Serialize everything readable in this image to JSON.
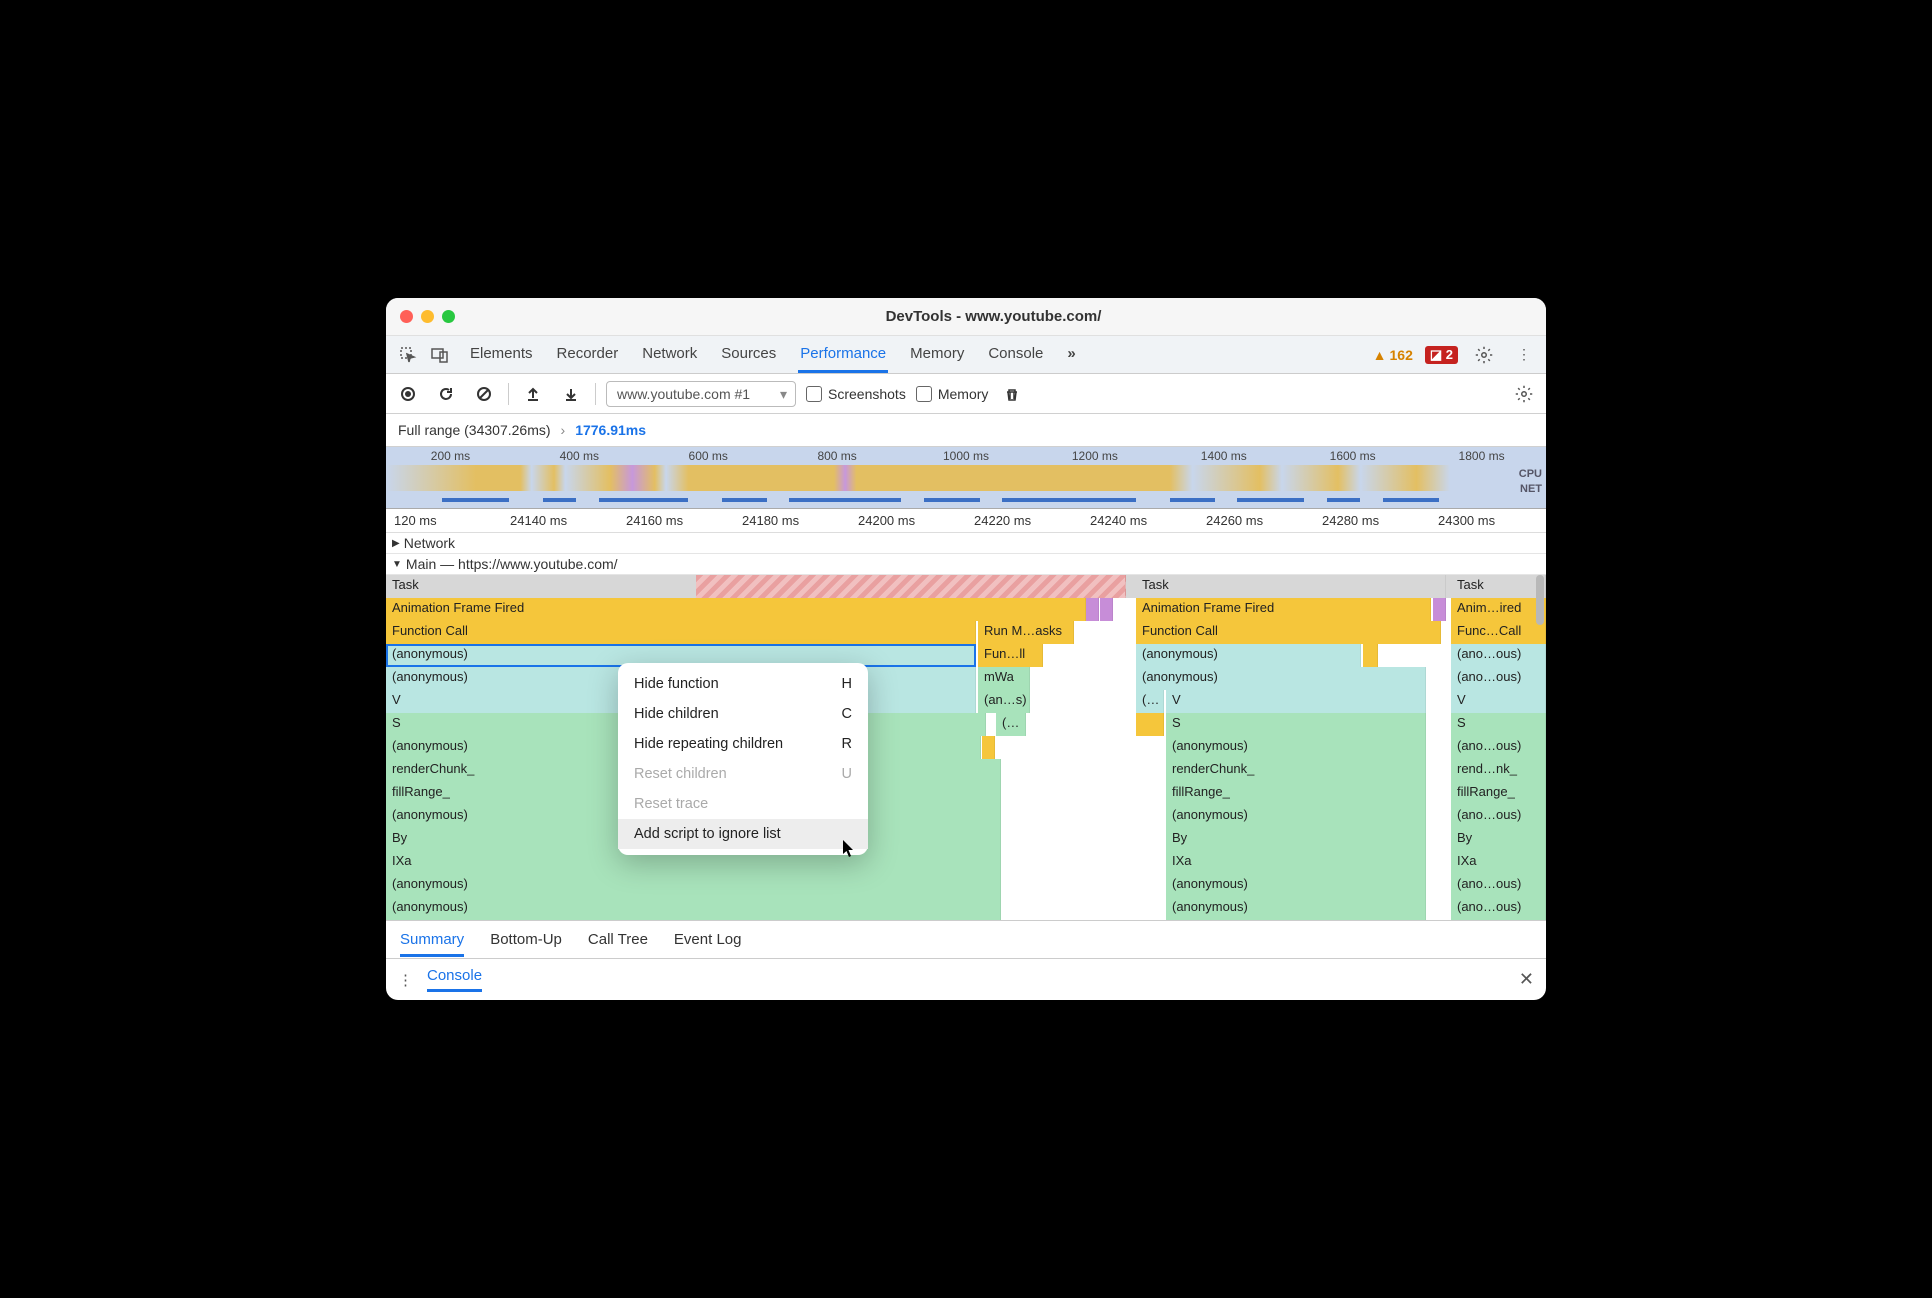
{
  "window": {
    "title": "DevTools - www.youtube.com/"
  },
  "tabs": [
    "Elements",
    "Recorder",
    "Network",
    "Sources",
    "Performance",
    "Memory",
    "Console"
  ],
  "active_tab": "Performance",
  "more_tabs_glyph": "»",
  "issues": {
    "warnings": 162,
    "errors": 2
  },
  "toolbar": {
    "profile_select": "www.youtube.com #1",
    "screenshots_label": "Screenshots",
    "memory_label": "Memory"
  },
  "breadcrumb": {
    "full": "Full range (34307.26ms)",
    "sep": "›",
    "current": "1776.91ms"
  },
  "overview_ticks": [
    "200 ms",
    "400 ms",
    "600 ms",
    "800 ms",
    "1000 ms",
    "1200 ms",
    "1400 ms",
    "1600 ms",
    "1800 ms"
  ],
  "overview_labels": {
    "cpu": "CPU",
    "net": "NET"
  },
  "ruler_ticks": [
    "120 ms",
    "24140 ms",
    "24160 ms",
    "24180 ms",
    "24200 ms",
    "24220 ms",
    "24240 ms",
    "24260 ms",
    "24280 ms",
    "24300 ms"
  ],
  "tracks": {
    "network": "Network",
    "main": "Main — https://www.youtube.com/"
  },
  "flame": {
    "col1": {
      "task": "Task",
      "aff": "Animation Frame Fired",
      "fc": "Function Call",
      "run": "Run M…asks",
      "anon1_sel": "(anonymous)",
      "fun2": "Fun…ll",
      "anon2": "(anonymous)",
      "mwa": "mWa",
      "v": "V",
      "ans": "(an…s)",
      "s": "S",
      "lp": "(…",
      "anon3": "(anonymous)",
      "rc": "renderChunk_",
      "fr": "fillRange_",
      "anon4": "(anonymous)",
      "by": "By",
      "ixa": "IXa",
      "anon5": "(anonymous)",
      "anon6": "(anonymous)"
    },
    "col2": {
      "task": "Task",
      "aff": "Animation Frame Fired",
      "fc": "Function Call",
      "anon1": "(anonymous)",
      "anon2": "(anonymous)",
      "lp": "(…",
      "v": "V",
      "s": "S",
      "anon3": "(anonymous)",
      "rc": "renderChunk_",
      "fr": "fillRange_",
      "anon4": "(anonymous)",
      "by": "By",
      "ixa": "IXa",
      "anon5": "(anonymous)",
      "anon6": "(anonymous)"
    },
    "col3": {
      "task": "Task",
      "aff": "Anim…ired",
      "fc": "Func…Call",
      "anon1": "(ano…ous)",
      "anon2": "(ano…ous)",
      "v": "V",
      "s": "S",
      "anon3": "(ano…ous)",
      "rc": "rend…nk_",
      "fr": "fillRange_",
      "anon4": "(ano…ous)",
      "by": "By",
      "ixa": "IXa",
      "anon5": "(ano…ous)",
      "anon6": "(ano…ous)"
    }
  },
  "context_menu": [
    {
      "label": "Hide function",
      "shortcut": "H",
      "enabled": true
    },
    {
      "label": "Hide children",
      "shortcut": "C",
      "enabled": true
    },
    {
      "label": "Hide repeating children",
      "shortcut": "R",
      "enabled": true
    },
    {
      "label": "Reset children",
      "shortcut": "U",
      "enabled": false
    },
    {
      "label": "Reset trace",
      "shortcut": "",
      "enabled": false
    },
    {
      "label": "Add script to ignore list",
      "shortcut": "",
      "enabled": true,
      "hovered": true
    }
  ],
  "bottom_tabs": [
    "Summary",
    "Bottom-Up",
    "Call Tree",
    "Event Log"
  ],
  "bottom_active": "Summary",
  "drawer": {
    "tab": "Console"
  }
}
